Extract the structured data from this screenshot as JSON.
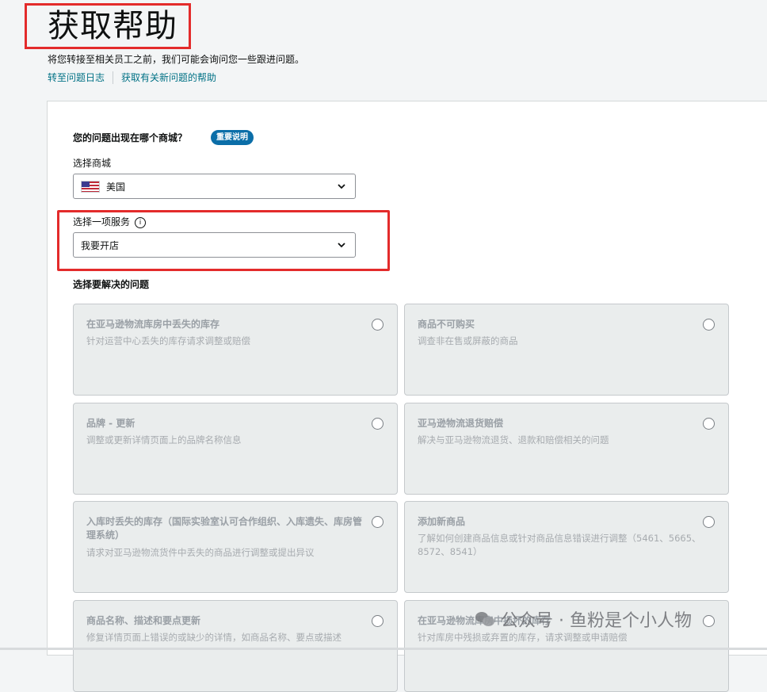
{
  "header": {
    "title": "获取帮助",
    "subtitle": "将您转接至相关员工之前，我们可能会询问您一些跟进问题。",
    "link_case_log": "转至问题日志",
    "link_new_issue": "获取有关新问题的帮助"
  },
  "form": {
    "marketplace_question": "您的问题出现在哪个商城？",
    "important_note_badge": "重要说明",
    "marketplace_label": "选择商城",
    "marketplace_value": "美国",
    "service_label": "选择一项服务",
    "service_value": "我要开店",
    "issues_label": "选择要解决的问题"
  },
  "issues": [
    {
      "title": "在亚马逊物流库房中丢失的库存",
      "desc": "针对运营中心丢失的库存请求调整或赔偿"
    },
    {
      "title": "商品不可购买",
      "desc": "调查非在售或屏蔽的商品"
    },
    {
      "title": "品牌 - 更新",
      "desc": "调整或更新详情页面上的品牌名称信息"
    },
    {
      "title": "亚马逊物流退货赔偿",
      "desc": "解决与亚马逊物流退货、退款和赔偿相关的问题"
    },
    {
      "title": "入库时丢失的库存（国际实验室认可合作组织、入库遗失、库房管理系统）",
      "desc": "请求对亚马逊物流货件中丢失的商品进行调整或提出异议"
    },
    {
      "title": "添加新商品",
      "desc": "了解如何创建商品信息或针对商品信息错误进行调整（5461、5665、8572、8541）"
    },
    {
      "title": "商品名称、描述和要点更新",
      "desc": "修复详情页面上错误的或缺少的详情，如商品名称、要点或描述"
    },
    {
      "title": "在亚马逊物流库房中损坏的库存",
      "desc": "针对库房中残损或弃置的库存，请求调整或申请赔偿"
    }
  ],
  "watermark": "公众号 · 鱼粉是个小人物",
  "colors": {
    "accent_link": "#007185",
    "badge": "#0b6ea8",
    "highlight_box": "#e32b2b"
  },
  "icons": {
    "flag": "us-flag-icon",
    "dropdown": "chevron-down-icon",
    "info": "info-icon",
    "radio": "radio-button"
  }
}
